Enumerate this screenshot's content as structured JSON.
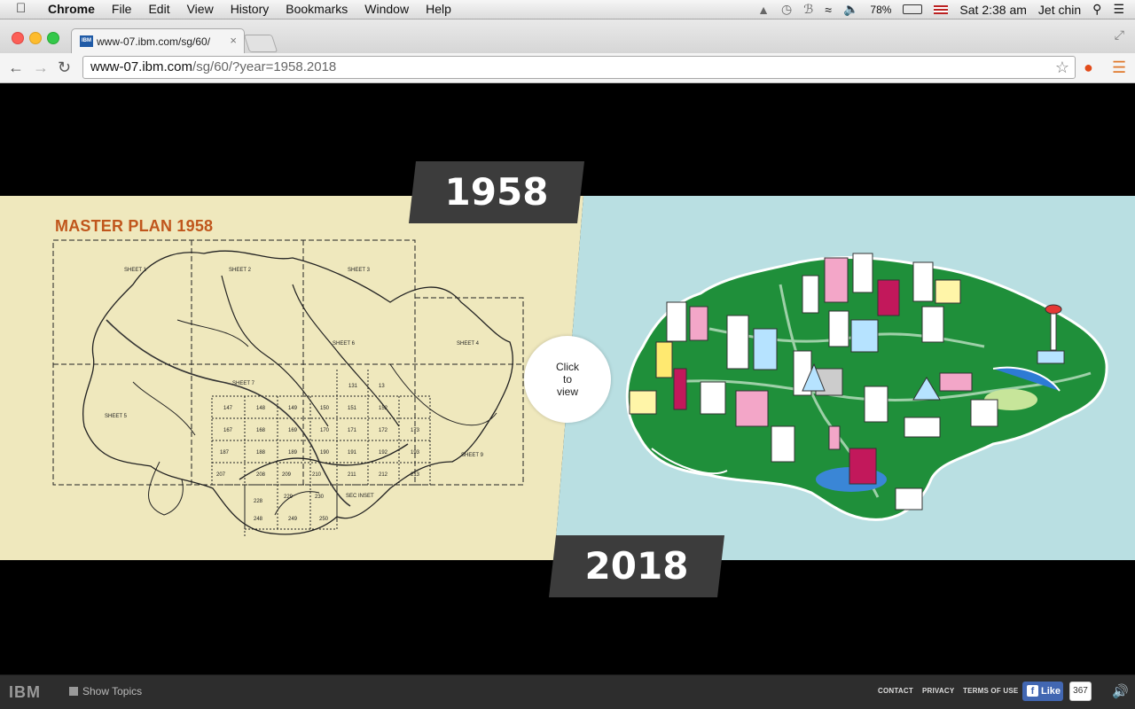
{
  "menubar": {
    "app_name": "Chrome",
    "menus": [
      "File",
      "Edit",
      "View",
      "History",
      "Bookmarks",
      "Window",
      "Help"
    ],
    "battery": "78%",
    "clock": "Sat 2:38 am",
    "user": "Jet chin"
  },
  "browser": {
    "tab_title": "www-07.ibm.com/sg/60/",
    "favicon_text": "IBM",
    "url_host": "www-07.ibm.com",
    "url_path": "/sg/60/?year=1958.2018"
  },
  "page": {
    "map_title": "MASTER PLAN 1958",
    "year_top": "1958",
    "year_bottom": "2018",
    "click_to_view": [
      "Click",
      "to",
      "view"
    ],
    "map_labels": {
      "sheets": [
        "SHEET 1",
        "SHEET 2",
        "SHEET 3",
        "SHEET 4",
        "SHEET 5",
        "SHEET 6",
        "SHEET 7",
        "SHEET 9"
      ],
      "grid_numbers": [
        "131",
        "13",
        "147",
        "148",
        "149",
        "150",
        "151",
        "152",
        "167",
        "168",
        "169",
        "170",
        "171",
        "172",
        "173",
        "187",
        "188",
        "189",
        "190",
        "191",
        "192",
        "193",
        "207",
        "208",
        "209",
        "210",
        "211",
        "212",
        "213",
        "228",
        "229",
        "230",
        "248",
        "249",
        "250"
      ],
      "inset": "SEC INSET"
    }
  },
  "footer": {
    "logo": "IBM",
    "show_topics": "Show Topics",
    "links": [
      "CONTACT",
      "PRIVACY",
      "TERMS OF USE"
    ],
    "like_label": "Like",
    "like_count": "367"
  },
  "colors": {
    "map_bg": "#efe8bd",
    "future_bg": "#b9dfe2",
    "title_orange": "#c0561c",
    "year_box": "#3c3c3c",
    "island_green": "#1f8f3a",
    "fb_blue": "#4267b2"
  }
}
